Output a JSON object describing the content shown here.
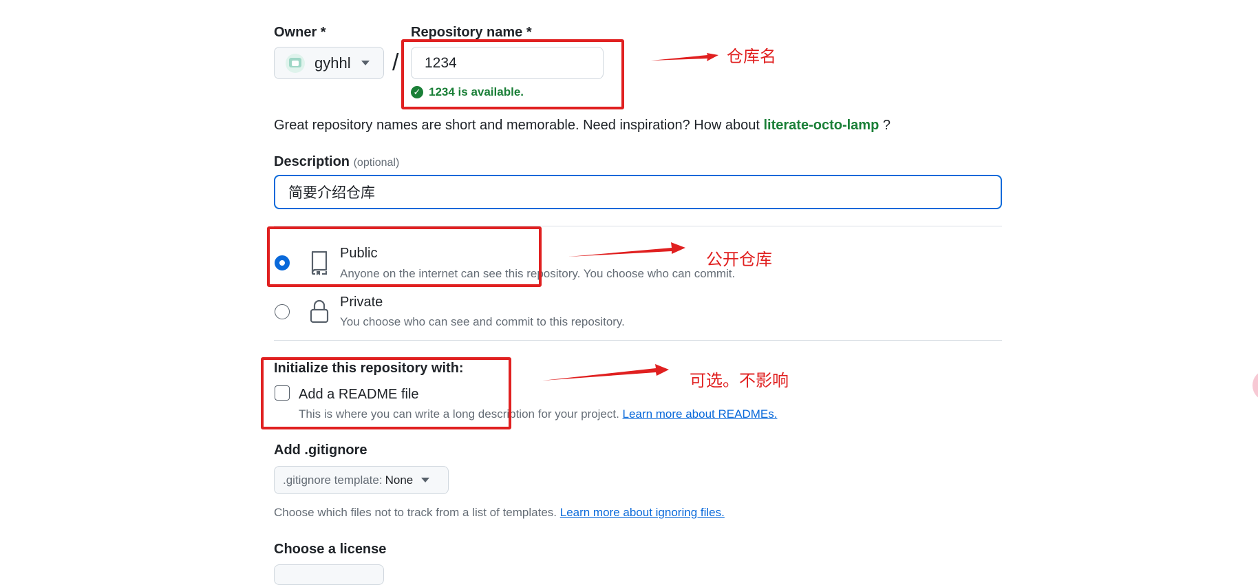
{
  "form": {
    "owner_label": "Owner *",
    "owner_value": "gyhhl",
    "separator": "/",
    "repo_name_label": "Repository name *",
    "repo_name_value": "1234",
    "availability": "1234 is available.",
    "hint_prefix": "Great repository names are short and memorable. Need inspiration? How about ",
    "hint_suggestion": "literate-octo-lamp",
    "hint_suffix": " ?",
    "description_label": "Description",
    "description_optional": "(optional)",
    "description_value": "简要介绍仓库",
    "visibility": [
      {
        "title": "Public",
        "subtitle": "Anyone on the internet can see this repository. You choose who can commit.",
        "selected": true
      },
      {
        "title": "Private",
        "subtitle": "You choose who can see and commit to this repository.",
        "selected": false
      }
    ],
    "init_label": "Initialize this repository with:",
    "readme_label": "Add a README file",
    "readme_desc": "This is where you can write a long description for your project. ",
    "readme_link": "Learn more about READMEs.",
    "gitignore_label": "Add .gitignore",
    "gitignore_select_label": ".gitignore template:",
    "gitignore_select_value": "None",
    "gitignore_desc": "Choose which files not to track from a list of templates. ",
    "gitignore_link": "Learn more about ignoring files.",
    "license_label": "Choose a license"
  },
  "annotations": {
    "repo_name_note": "仓库名",
    "public_note": "公开仓库",
    "init_note": "可选。不影响"
  },
  "colors": {
    "accent_blue": "#0969da",
    "success_green": "#1a7f37",
    "annotation_red": "#e02020"
  },
  "icons": {
    "repo": "repo-icon",
    "lock": "lock-icon",
    "check": "check-circle-icon"
  }
}
